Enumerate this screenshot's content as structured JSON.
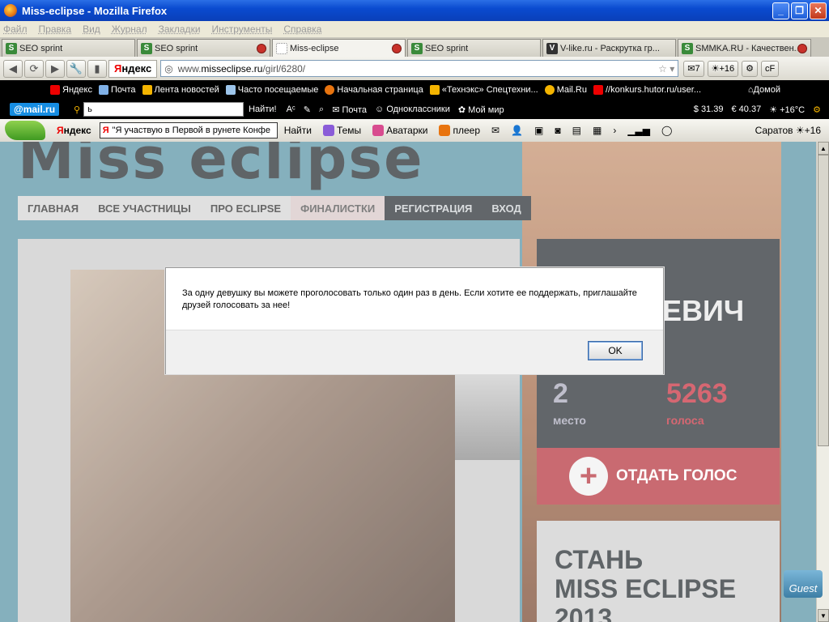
{
  "window": {
    "title": "Miss-eclipse - Mozilla Firefox"
  },
  "menu": [
    "Файл",
    "Правка",
    "Вид",
    "Журнал",
    "Закладки",
    "Инструменты",
    "Справка"
  ],
  "tabs": [
    {
      "label": "SEO sprint",
      "fav": "S"
    },
    {
      "label": "SEO sprint",
      "fav": "S"
    },
    {
      "label": "Miss-eclipse",
      "fav": ""
    },
    {
      "label": "SEO sprint",
      "fav": "S"
    },
    {
      "label": "V-like.ru - Раскрутка гр...",
      "fav": "V"
    },
    {
      "label": "SMMKA.RU - Качествен...",
      "fav": "S"
    }
  ],
  "nav": {
    "yandex_logo": "Яндекс",
    "url_prefix": "www.",
    "url_domain": "misseclipse.ru",
    "url_path": "/girl/6280/",
    "mail_count": "7",
    "weather": "+16"
  },
  "bookmarks": [
    "Яндекс",
    "Почта",
    "Лента новостей",
    "Часто посещаемые",
    "Начальная страница",
    "«Технэкс» Спецтехни...",
    "Mail.Ru",
    "//konkurs.hutor.ru/user..."
  ],
  "bookmark_home": "Домой",
  "mailbar": {
    "logo": "@mail.ru",
    "search_value": "ь",
    "search_btn": "Найти!",
    "links": [
      "Почта",
      "Одноклассники",
      "Мой мир"
    ],
    "rates": [
      "31.39",
      "40.37",
      "+16°C"
    ]
  },
  "yabar": {
    "logo": "Яндекс",
    "input_value": "\"Я участвую в Первой в рунете Конфе",
    "find": "Найти",
    "themes": "Темы",
    "avatars": "Аватарки",
    "player": "плеер",
    "city": "Саратов",
    "temp": "+16"
  },
  "site": {
    "logo_text": "Miss eclipse",
    "nav": [
      "ГЛАВНАЯ",
      "ВСЕ УЧАСТНИЦЫ",
      "ПРО ECLIPSE",
      "ФИНАЛИСТКИ",
      "РЕГИСТРАЦИЯ",
      "ВХОД"
    ],
    "name_partial": "ЕВИЧ",
    "rank": "2",
    "rank_label": "место",
    "votes": "5263",
    "votes_label": "голоса",
    "vote_button": "ОТДАТЬ ГОЛОС",
    "become_line1": "СТАНЬ",
    "become_line2": "MISS ECLIPSE",
    "become_line3": "2013"
  },
  "dialog": {
    "message": "За одну девушку вы можете проголосовать только один раз в день. Если хотите ее поддержать, приглашайте друзей голосовать за нее!",
    "ok": "OK"
  },
  "guest_badge": "Guest"
}
